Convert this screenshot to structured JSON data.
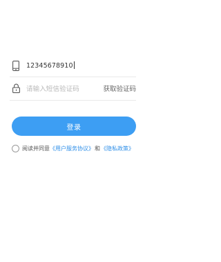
{
  "login_form": {
    "phone": {
      "icon": "mobile-phone-icon",
      "value": "12345678910"
    },
    "code": {
      "icon": "lock-icon",
      "placeholder": "请输入短信验证码",
      "get_code_label": "获取验证码"
    },
    "login_button_label": "登录",
    "agreement": {
      "prefix": "阅读并同意",
      "user_agreement": "《用户服务协议》",
      "and": "和",
      "privacy_policy": "《隐私政策》"
    }
  },
  "colors": {
    "accent": "#3d9ef3",
    "link": "#2f8fe8",
    "placeholder": "#b8b8b8",
    "divider": "#e9e9e9"
  }
}
